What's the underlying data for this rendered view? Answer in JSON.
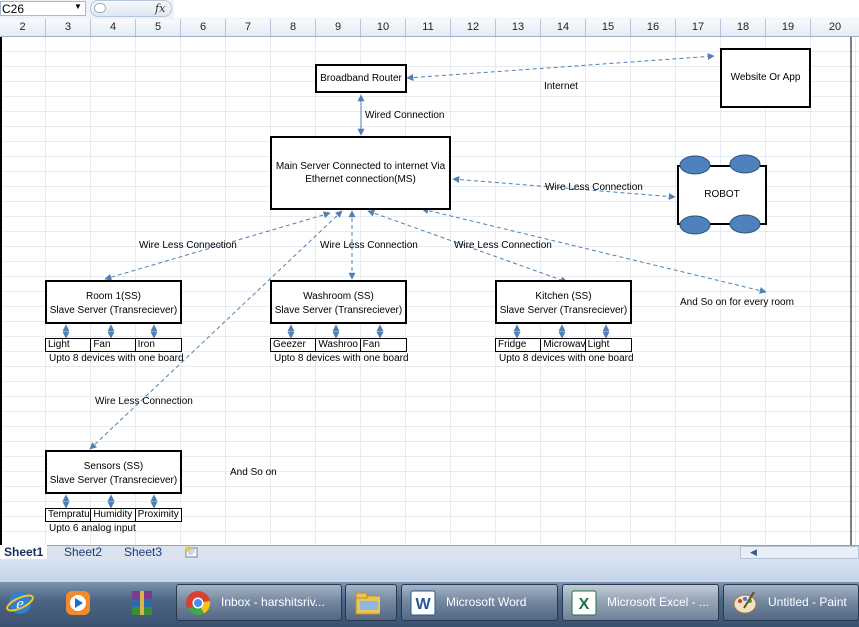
{
  "formula_bar": {
    "name_box": "C26",
    "fx": "fx",
    "formula": ""
  },
  "columns": [
    "2",
    "3",
    "4",
    "5",
    "6",
    "7",
    "8",
    "9",
    "10",
    "11",
    "12",
    "13",
    "14",
    "15",
    "16",
    "17",
    "18",
    "19",
    "20"
  ],
  "diagram": {
    "router": "Broadband Router",
    "website": "Website Or App",
    "internet": "Internet",
    "wired": "Wired Connection",
    "main_server_line1": "Main Server Connected to internet Via",
    "main_server_line2": "Ethernet connection(MS)",
    "robot": "ROBOT",
    "wl_robot": "Wire Less Connection",
    "wl_room": "Wire Less Connection",
    "wl_wash": "Wire Less Connection",
    "wl_kitchen": "Wire Less Connection",
    "wl_sensors": "Wire Less Connection",
    "and_so_on_room": "And So on for every room",
    "and_so_on": "And So on",
    "slave_line": "Slave Server (Transreciever)",
    "room1": {
      "title": "Room 1(SS)",
      "devices": [
        "Light",
        "Fan",
        "Iron"
      ],
      "note": "Upto 8 devices with one board"
    },
    "washroom": {
      "title": "Washroom (SS)",
      "devices": [
        "Geezer",
        "Washroo",
        "Fan"
      ],
      "note": "Upto 8 devices with one board"
    },
    "kitchen": {
      "title": "Kitchen (SS)",
      "devices": [
        "Fridge",
        "Microwav",
        "Light"
      ],
      "note": "Upto 8 devices with one board"
    },
    "sensors": {
      "title": "Sensors (SS)",
      "devices": [
        "Tempratu",
        "Humidity",
        "Proximity"
      ],
      "note": "Upto 6 analog input"
    }
  },
  "sheets": {
    "tabs": [
      "Sheet1",
      "Sheet2",
      "Sheet3"
    ],
    "active": "Sheet1"
  },
  "taskbar": {
    "buttons": [
      "Inbox - harshitsriv...",
      "",
      "Microsoft Word",
      "Microsoft Excel - ...",
      "Untitled - Paint"
    ]
  },
  "colors": {
    "arrow": "#4f7fb4",
    "robot_wheel": "#4f81bd",
    "grid_line": "#d0d7e5"
  }
}
